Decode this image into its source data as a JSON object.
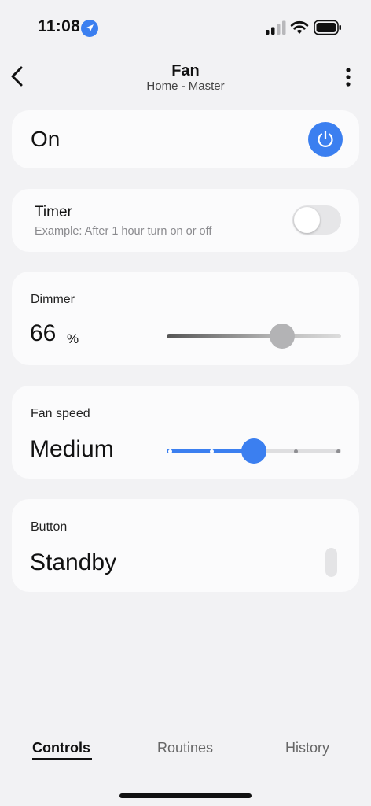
{
  "status_bar": {
    "time": "11:08",
    "icons": [
      "location-arrow-icon",
      "cellular-signal-icon",
      "wifi-icon",
      "battery-icon"
    ]
  },
  "header": {
    "title": "Fan",
    "subtitle": "Home - Master",
    "back_icon": "chevron-left-icon",
    "more_icon": "more-vertical-icon"
  },
  "power": {
    "label": "On",
    "icon": "power-icon",
    "color": "#3b7ff0"
  },
  "timer": {
    "title": "Timer",
    "example": "Example: After 1 hour turn on or off",
    "enabled": false
  },
  "dimmer": {
    "label": "Dimmer",
    "value": "66",
    "unit": "%",
    "level_percent": 66
  },
  "fan_speed": {
    "label": "Fan speed",
    "value": "Medium",
    "step_count": 5,
    "selected_step": 2
  },
  "button": {
    "label": "Button",
    "value": "Standby"
  },
  "tabs": [
    {
      "label": "Controls",
      "active": true
    },
    {
      "label": "Routines",
      "active": false
    },
    {
      "label": "History",
      "active": false
    }
  ],
  "colors": {
    "accent": "#3b7ff0",
    "background": "#f2f2f4",
    "card": "#fbfbfc"
  }
}
